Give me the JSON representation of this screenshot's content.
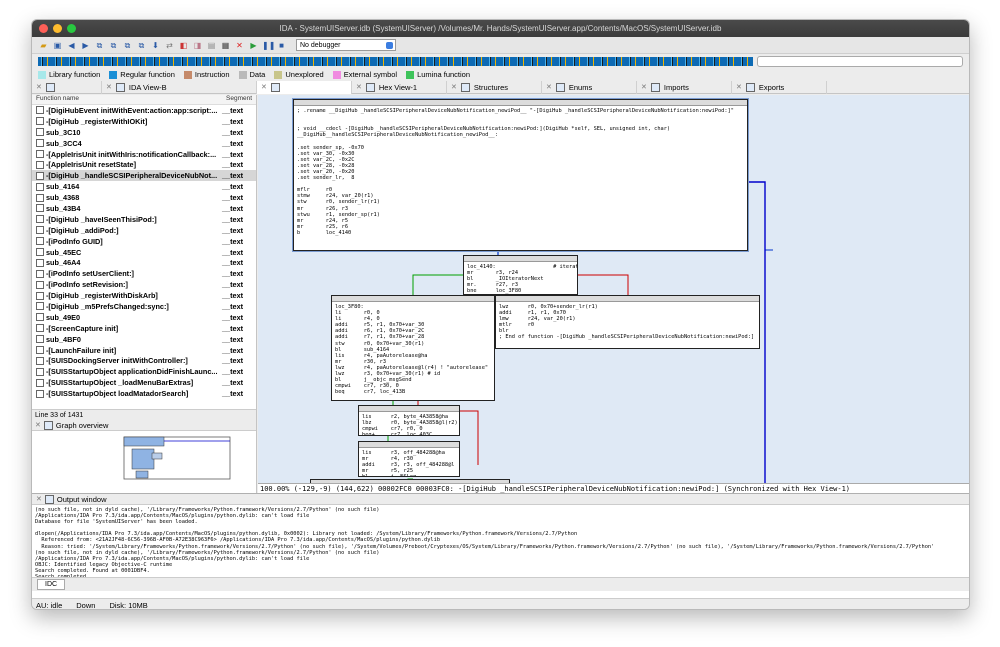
{
  "window": {
    "title": "IDA - SystemUIServer.idb (SystemUIServer) /Volumes/Mr. Hands/SystemUIServer.app/Contents/MacOS/SystemUIServer.idb"
  },
  "toolbar": {
    "debugger": "No debugger"
  },
  "legend": [
    {
      "label": "Library function",
      "color": "#a7e8ea"
    },
    {
      "label": "Regular function",
      "color": "#1a8fd6"
    },
    {
      "label": "Instruction",
      "color": "#c58a6a"
    },
    {
      "label": "Data",
      "color": "#b9b9b9"
    },
    {
      "label": "Unexplored",
      "color": "#c8c58a"
    },
    {
      "label": "External symbol",
      "color": "#f08be0"
    },
    {
      "label": "Lumina function",
      "color": "#3ec35a"
    }
  ],
  "tabs": {
    "functions_title": "Functions",
    "ida_view": "IDA View-B",
    "hex_view": "Hex View-1",
    "structures": "Structures",
    "enums": "Enums",
    "imports": "Imports",
    "exports": "Exports"
  },
  "functions": {
    "col_name": "Function name",
    "col_segment": "Segment",
    "rows": [
      {
        "name": "-[DigiHubEvent initWithEvent:action:app:script:...",
        "seg": "__text"
      },
      {
        "name": "-[DigiHub _registerWithIOKit]",
        "seg": "__text"
      },
      {
        "name": "sub_3C10",
        "seg": "__text"
      },
      {
        "name": "sub_3CC4",
        "seg": "__text"
      },
      {
        "name": "-[AppleIrisUnit initWithIris:notificationCallback:...",
        "seg": "__text"
      },
      {
        "name": "-[AppleIrisUnit resetState]",
        "seg": "__text"
      },
      {
        "name": "-[DigiHub _handleSCSIPeripheralDeviceNubNot...",
        "seg": "__text"
      },
      {
        "name": "sub_4164",
        "seg": "__text"
      },
      {
        "name": "sub_4368",
        "seg": "__text"
      },
      {
        "name": "sub_43B4",
        "seg": "__text"
      },
      {
        "name": "-[DigiHub _haveISeenThisiPod:]",
        "seg": "__text"
      },
      {
        "name": "-[DigiHub _addiPod:]",
        "seg": "__text"
      },
      {
        "name": "-[iPodInfo GUID]",
        "seg": "__text"
      },
      {
        "name": "sub_45EC",
        "seg": "__text"
      },
      {
        "name": "sub_46A4",
        "seg": "__text"
      },
      {
        "name": "-[iPodInfo setUserClient:]",
        "seg": "__text"
      },
      {
        "name": "-[iPodInfo setRevision:]",
        "seg": "__text"
      },
      {
        "name": "-[DigiHub _registerWithDiskArb]",
        "seg": "__text"
      },
      {
        "name": "-[DigiHub _m5PrefsChanged:sync:]",
        "seg": "__text"
      },
      {
        "name": "sub_49E0",
        "seg": "__text"
      },
      {
        "name": "-[ScreenCapture init]",
        "seg": "__text"
      },
      {
        "name": "sub_4BF0",
        "seg": "__text"
      },
      {
        "name": "-[LaunchFailure init]",
        "seg": "__text"
      },
      {
        "name": "-[SUISDockingServer initWithController:]",
        "seg": "__text"
      },
      {
        "name": "-[SUISStartupObject applicationDidFinishLaunc...",
        "seg": "__text"
      },
      {
        "name": "-[SUISStartupObject _loadMenuBarExtras]",
        "seg": "__text"
      },
      {
        "name": "-[SUISStartupObject loadMatadorSearch]",
        "seg": "__text"
      }
    ],
    "line_info": "Line 33 of 1431"
  },
  "graph_overview": {
    "title": "Graph overview"
  },
  "graph": {
    "status": "100.00% (-129,-9) (144,622) 00002FC0 00003FC0: -[DigiHub _handleSCSIPeripheralDeviceNubNotification:newiPod:] (Synchronized with Hex View-1)",
    "nodes": [
      {
        "id": "main",
        "text": "; .rename __DigiHub _handleSCSIPeripheralDeviceNubNotification_newiPod__ \"-[DigiHub _handleSCSIPeripheralDeviceNubNotification:newiPod:]\"\n\n\n; void __cdecl -[DigiHub _handleSCSIPeripheralDeviceNubNotification:newiPod:](DigiHub *self, SEL, unsigned int, char)\n__DigiHub__handleSCSIPeripheralDeviceNubNotification_newiPod__:\n\n.set sender_sp, -0x70\n.set var_30, -0x30\n.set var_2C, -0x2C\n.set var_28, -0x28\n.set var_20, -0x20\n.set sender_lr,  8\n\nmflr     r0\nstmw     r24, var_20(r1)\nstw      r0, sender_lr(r1)\nmr       r26, r3\nstwu     r1, sender_sp(r1)\nmr       r24, r5\nmr       r25, r6\nb        loc_4140"
      },
      {
        "id": "loop",
        "text": "loc_4140:                  # iterator\nmr       r3, r24\nbl       _IOIteratorNext\nmr.      r27, r3\nbne      loc_3F80"
      },
      {
        "id": "body",
        "text": "loc_3F80:\nli       r0, 0\nli       r4, 0\naddi     r5, r1, 0x70+var_30\naddi     r6, r1, 0x70+var_2C\naddi     r7, r1, 0x70+var_28\nstw      r0, 0x70+var_30(r1)\nbl       sub_4164\nlis      r4, paAutorelease@ha\nmr       r30, r3\nlwz      r4, paAutorelease@l(r4) ! \"autorelease\"\nlwz      r3, 0x70+var_30(r1) # id\nbl       j__objc_msgSend\ncmpwi    cr7, r30, 0\nbeq      cr7, loc_413B"
      },
      {
        "id": "exit",
        "text": "lwz      r0, 0x70+sender_lr(r1)\naddi     r1, r1, 0x70\nlmw      r24, var_20(r1)\nmtlr     r0\nblr\n; End of function -[DigiHub _handleSCSIPeripheralDeviceNubNotification:newiPod:]"
      },
      {
        "id": "n4",
        "text": "lis      r2, byte_4A3858@ha\nlbz      r0, byte_4A3858@l(r2)\ncmpwi    cr7, r0, 0\nbeq+     cr7, loc_403C"
      },
      {
        "id": "n5",
        "text": "lis      r3, off_484288@ha\nmr       r4, r30\naddi     r3, r3, off_484288@l\nmr       r5, r25\nbl       j__NSLog"
      },
      {
        "id": "n6",
        "text": ""
      }
    ]
  },
  "output": {
    "title": "Output window",
    "text": "(no such file, not in dyld cache), '/Library/Frameworks/Python.framework/Versions/2.7/Python' (no such file)\n/Applications/IDA Pro 7.3/ida.app/Contents/MacOS/plugins/python.dylib: can't load file\nDatabase for file 'SystemUIServer' has been loaded.\n\ndlopen(/Applications/IDA Pro 7.3/ida.app/Contents/MacOS/plugins/python.dylib, 0x0002): Library not loaded: /System/Library/Frameworks/Python.framework/Versions/2.7/Python\n  Referenced from: <21A2JF48-6C56-396B-AF0B-A72E38C963F6> /Applications/IDA Pro 7.3/ida.app/Contents/MacOS/plugins/python.dylib\n  Reason: tried: '/System/Library/Frameworks/Python.framework/Versions/2.7/Python' (no such file), '/System/Volumes/Preboot/Cryptexes/OS/System/Library/Frameworks/Python.framework/Versions/2.7/Python' (no such file), '/System/Library/Frameworks/Python.framework/Versions/2.7/Python'\n(no such file, not in dyld cache), '/Library/Frameworks/Python.framework/Versions/2.7/Python' (no such file)\n/Applications/IDA Pro 7.3/ida.app/Contents/MacOS/plugins/python.dylib: can't load file\nOBJC: Identified legacy Objective-C runtime\nSearch completed. Found at 0001DBF4.\nSearch completed",
    "idc": "IDC"
  },
  "statusbar": {
    "au": "AU:  idle",
    "dir": "Down",
    "disk": "Disk: 10MB"
  }
}
